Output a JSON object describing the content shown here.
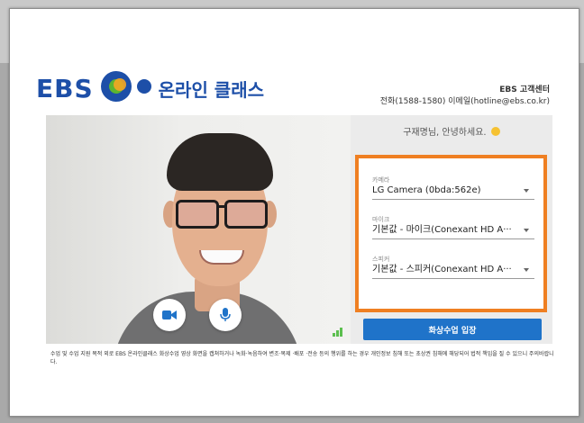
{
  "brand": {
    "ebs": "EBS",
    "service_name": "온라인 클래스",
    "colors": {
      "blue": "#1d4fa8",
      "green": "#5cb531",
      "orange": "#f5a623"
    }
  },
  "support": {
    "title": "EBS 고객센터",
    "contact": "전화(1588-1580) 이메일(hotline@ebs.co.kr)"
  },
  "video": {
    "camera_icon": "video-camera-icon",
    "mic_icon": "microphone-icon",
    "signal_icon": "signal-bars-icon"
  },
  "panel": {
    "greeting": "구재명님, 안녕하세요.",
    "greeting_icon": "smile-icon",
    "camera": {
      "label": "카메라",
      "value": "LG Camera (0bda:562e)"
    },
    "mic": {
      "label": "마이크",
      "value": "기본값 - 마이크(Conexant HD A···"
    },
    "speaker": {
      "label": "스피커",
      "value": "기본값 - 스피커(Conexant HD A···"
    },
    "highlight_color": "#ef7f22",
    "enter_button": "화상수업 입장",
    "enter_button_color": "#1f73c9"
  },
  "notice": "수업 및 수업 지원 목적 외로 EBS 온라인클래스 화상수업 영상 화면을 캡쳐하거나 녹화·녹음하여 변조·복제 ·배포 ·전송 등의 행위를 하는 경우 개인정보 침해 또는 초상권 침해에 해당되어 법적 책임을 질 수 있으니 주의바랍니다."
}
